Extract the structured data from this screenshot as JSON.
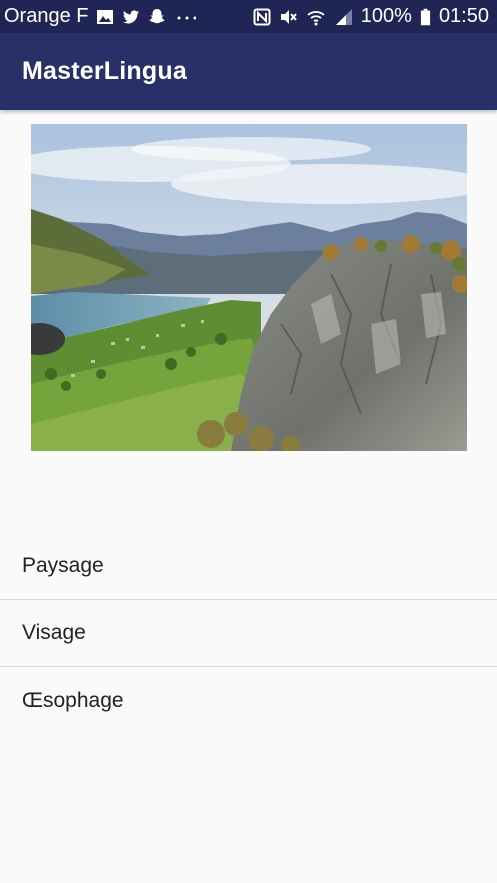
{
  "status_bar": {
    "carrier": "Orange F",
    "battery": "100%",
    "time": "01:50",
    "left_icons": [
      "gallery-icon",
      "twitter-icon",
      "snapchat-icon",
      "more-dots-icon"
    ],
    "right_icons": [
      "nfc-icon",
      "mute-icon",
      "wifi-icon",
      "signal-icon",
      "battery-icon"
    ]
  },
  "app_bar": {
    "title": "MasterLingua",
    "color": "#283067"
  },
  "image": {
    "description_icon": "landscape-photo"
  },
  "list": {
    "items": [
      {
        "label": "Paysage"
      },
      {
        "label": "Visage"
      },
      {
        "label": "Œsophage"
      }
    ]
  }
}
